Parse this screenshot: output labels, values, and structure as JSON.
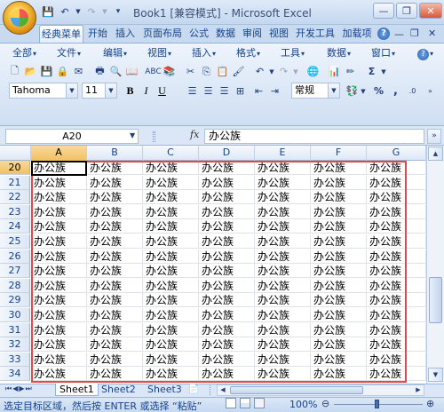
{
  "window": {
    "title": "Book1 [兼容模式] - Microsoft Excel",
    "minimize_glyph": "—",
    "restore_glyph": "❐",
    "close_glyph": "✕"
  },
  "ribbon_tabs": [
    "经典菜单",
    "开始",
    "插入",
    "页面布局",
    "公式",
    "数据",
    "审阅",
    "视图",
    "开发工具",
    "加载项"
  ],
  "help_glyph": "?",
  "classic_menus": [
    "全部",
    "文件",
    "编辑",
    "视图",
    "插入",
    "格式",
    "工具",
    "数据",
    "窗口"
  ],
  "font": {
    "name": "Tahoma",
    "size": "11"
  },
  "format_buttons": {
    "bold": "B",
    "italic": "I",
    "underline": "U"
  },
  "number_format": "常规",
  "percent_glyph": "%",
  "sigma_glyph": "Σ",
  "name_box": "A20",
  "fx_label": "fx",
  "formula_value": "办公族",
  "columns": [
    "A",
    "B",
    "C",
    "D",
    "E",
    "F",
    "G"
  ],
  "rows": [
    "20",
    "21",
    "22",
    "23",
    "24",
    "25",
    "26",
    "27",
    "28",
    "29",
    "30",
    "31",
    "32",
    "33",
    "34"
  ],
  "cell_text": "办公族",
  "sheets": [
    "Sheet1",
    "Sheet2",
    "Sheet3"
  ],
  "status_text": "选定目标区域，然后按 ENTER 或选择 “粘贴”",
  "zoom": "100%",
  "zoom_minus": "⊖",
  "zoom_plus": "⊕",
  "colors": {
    "accent": "#15428b",
    "selection": "#e24848",
    "ribbon": "#dbe7f6"
  }
}
